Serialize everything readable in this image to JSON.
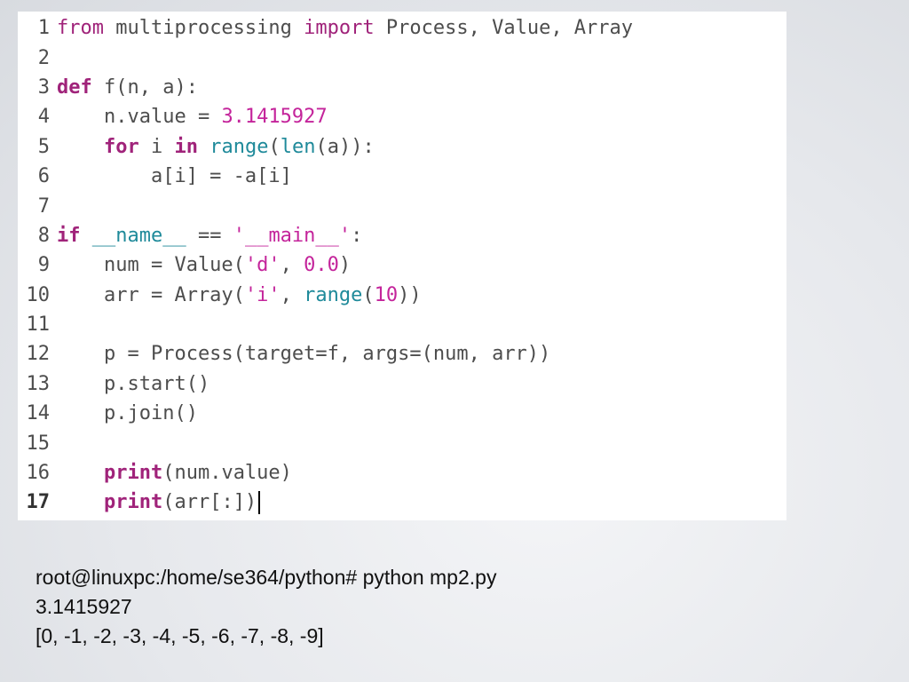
{
  "editor": {
    "lines": [
      {
        "n": "1",
        "tokens": [
          [
            "kw2",
            "from"
          ],
          [
            "p",
            " multiprocessing "
          ],
          [
            "kw2",
            "import"
          ],
          [
            "p",
            " Process, Value, Array"
          ]
        ]
      },
      {
        "n": "2",
        "tokens": []
      },
      {
        "n": "3",
        "tokens": [
          [
            "kw",
            "def"
          ],
          [
            "p",
            " f(n, a):"
          ]
        ]
      },
      {
        "n": "4",
        "tokens": [
          [
            "p",
            "    n.value = "
          ],
          [
            "num",
            "3.1415927"
          ]
        ]
      },
      {
        "n": "5",
        "tokens": [
          [
            "p",
            "    "
          ],
          [
            "kw",
            "for"
          ],
          [
            "p",
            " i "
          ],
          [
            "kw",
            "in"
          ],
          [
            "p",
            " "
          ],
          [
            "bi",
            "range"
          ],
          [
            "p",
            "("
          ],
          [
            "bi",
            "len"
          ],
          [
            "p",
            "(a)):"
          ]
        ]
      },
      {
        "n": "6",
        "tokens": [
          [
            "p",
            "        a[i] = -a[i]"
          ]
        ]
      },
      {
        "n": "7",
        "tokens": []
      },
      {
        "n": "8",
        "tokens": [
          [
            "kw",
            "if"
          ],
          [
            "p",
            " "
          ],
          [
            "bi",
            "__name__"
          ],
          [
            "p",
            " == "
          ],
          [
            "str",
            "'__main__'"
          ],
          [
            "p",
            ":"
          ]
        ]
      },
      {
        "n": "9",
        "tokens": [
          [
            "p",
            "    num = Value("
          ],
          [
            "str",
            "'d'"
          ],
          [
            "p",
            ", "
          ],
          [
            "num",
            "0.0"
          ],
          [
            "p",
            ")"
          ]
        ]
      },
      {
        "n": "10",
        "tokens": [
          [
            "p",
            "    arr = Array("
          ],
          [
            "str",
            "'i'"
          ],
          [
            "p",
            ", "
          ],
          [
            "bi",
            "range"
          ],
          [
            "p",
            "("
          ],
          [
            "num",
            "10"
          ],
          [
            "p",
            "))"
          ]
        ]
      },
      {
        "n": "11",
        "tokens": []
      },
      {
        "n": "12",
        "tokens": [
          [
            "p",
            "    p = Process(target=f, args=(num, arr))"
          ]
        ]
      },
      {
        "n": "13",
        "tokens": [
          [
            "p",
            "    p.start()"
          ]
        ]
      },
      {
        "n": "14",
        "tokens": [
          [
            "p",
            "    p.join()"
          ]
        ]
      },
      {
        "n": "15",
        "tokens": []
      },
      {
        "n": "16",
        "tokens": [
          [
            "p",
            "    "
          ],
          [
            "fn",
            "print"
          ],
          [
            "p",
            "(num.value)"
          ]
        ]
      },
      {
        "n": "17",
        "tokens": [
          [
            "p",
            "    "
          ],
          [
            "fn",
            "print"
          ],
          [
            "p",
            "(arr[:])"
          ]
        ]
      }
    ],
    "current_line": "17"
  },
  "terminal": {
    "lines": [
      "root@linuxpc:/home/se364/python# python mp2.py",
      "3.1415927",
      "[0, -1, -2, -3, -4, -5, -6, -7, -8, -9]"
    ]
  }
}
